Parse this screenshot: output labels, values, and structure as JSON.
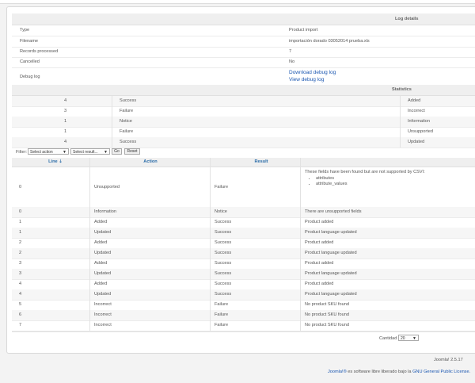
{
  "log_details": {
    "header": "Log details",
    "rows": [
      {
        "label": "Type",
        "value": "Product import"
      },
      {
        "label": "Filename",
        "value": "importación dorado 03052014 prueba.xls"
      },
      {
        "label": "Records processed",
        "value": "7"
      },
      {
        "label": "Cancelled",
        "value": "No"
      }
    ],
    "debug_label": "Debug log",
    "download_link": "Download debug log",
    "view_link": "View debug log"
  },
  "statistics": {
    "header": "Statistics",
    "rows": [
      {
        "count": "4",
        "result": "Success",
        "action": "Added"
      },
      {
        "count": "3",
        "result": "Failure",
        "action": "Incorrect"
      },
      {
        "count": "1",
        "result": "Notice",
        "action": "Information"
      },
      {
        "count": "1",
        "result": "Failure",
        "action": "Unsupported"
      },
      {
        "count": "4",
        "result": "Success",
        "action": "Updated"
      }
    ]
  },
  "filter": {
    "label": "Filter:",
    "action_select": "Select action",
    "result_select": "Select result...",
    "go": "Go",
    "reset": "Reset"
  },
  "table": {
    "columns": [
      "Line",
      "Action",
      "Result"
    ],
    "sort_icon": "sort-ascending-icon",
    "first_row": {
      "line": "0",
      "action": "Unsupported",
      "result": "Failure",
      "message": "These fields have been found but are not supported by CSVI:",
      "fields": [
        "attributes",
        "attribute_values"
      ]
    },
    "rows": [
      {
        "line": "0",
        "action": "Information",
        "result": "Notice",
        "message": "There are unsupported fields"
      },
      {
        "line": "1",
        "action": "Added",
        "result": "Success",
        "message": "Product added"
      },
      {
        "line": "1",
        "action": "Updated",
        "result": "Success",
        "message": "Product language updated"
      },
      {
        "line": "2",
        "action": "Added",
        "result": "Success",
        "message": "Product added"
      },
      {
        "line": "2",
        "action": "Updated",
        "result": "Success",
        "message": "Product language updated"
      },
      {
        "line": "3",
        "action": "Added",
        "result": "Success",
        "message": "Product added"
      },
      {
        "line": "3",
        "action": "Updated",
        "result": "Success",
        "message": "Product language updated"
      },
      {
        "line": "4",
        "action": "Added",
        "result": "Success",
        "message": "Product added"
      },
      {
        "line": "4",
        "action": "Updated",
        "result": "Success",
        "message": "Product language updated"
      },
      {
        "line": "5",
        "action": "Incorrect",
        "result": "Failure",
        "message": "No product SKU found"
      },
      {
        "line": "6",
        "action": "Incorrect",
        "result": "Failure",
        "message": "No product SKU found"
      },
      {
        "line": "7",
        "action": "Incorrect",
        "result": "Failure",
        "message": "No product SKU found"
      }
    ]
  },
  "pagination": {
    "label": "Cantidad",
    "value": "20"
  },
  "footer": {
    "version": "Joomla! 2.5.17",
    "joomla_link": "Joomla!®",
    "middle_text": "es software libre liberado bajo la",
    "license_link": "GNU General Public License."
  },
  "colors": {
    "link": "#1b57b1",
    "header_text": "#2a6ca8"
  }
}
